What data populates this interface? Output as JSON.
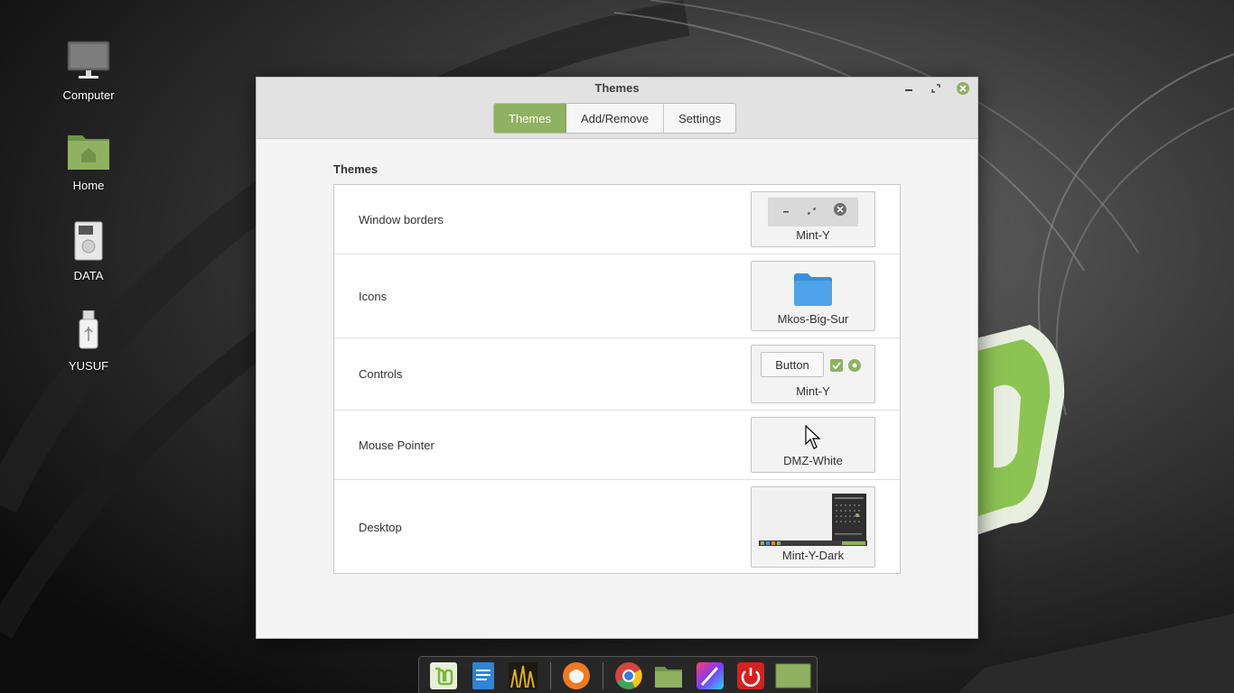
{
  "desktop": {
    "icons": [
      {
        "label": "Computer",
        "icon": "computer-icon"
      },
      {
        "label": "Home",
        "icon": "home-folder-icon"
      },
      {
        "label": "DATA",
        "icon": "drive-icon"
      },
      {
        "label": "YUSUF",
        "icon": "usb-drive-icon"
      }
    ]
  },
  "window": {
    "title": "Themes",
    "tabs": [
      {
        "label": "Themes",
        "active": true
      },
      {
        "label": "Add/Remove",
        "active": false
      },
      {
        "label": "Settings",
        "active": false
      }
    ],
    "section_title": "Themes",
    "rows": [
      {
        "label": "Window borders",
        "value": "Mint-Y"
      },
      {
        "label": "Icons",
        "value": "Mkos-Big-Sur"
      },
      {
        "label": "Controls",
        "value": "Mint-Y",
        "button_label": "Button"
      },
      {
        "label": "Mouse Pointer",
        "value": "DMZ-White"
      },
      {
        "label": "Desktop",
        "value": "Mint-Y-Dark"
      }
    ]
  },
  "colors": {
    "accent": "#8fb162",
    "folder_blue": "#4fa3ea",
    "close_green": "#8fb162",
    "dock_red": "#d62020"
  },
  "dock": {
    "items": [
      "mint-menu-icon",
      "text-editor-icon",
      "image-viewer-icon",
      "firefox-icon",
      "chrome-icon",
      "files-icon",
      "paint-icon",
      "power-icon",
      "folder-icon"
    ]
  }
}
